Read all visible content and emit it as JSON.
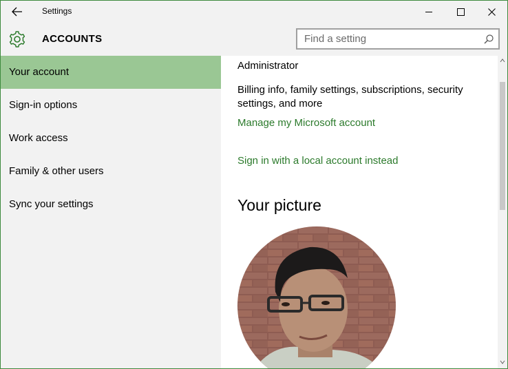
{
  "window": {
    "title": "Settings",
    "back_icon": "back-arrow-icon",
    "minimize_icon": "minimize-icon",
    "maximize_icon": "maximize-icon",
    "close_icon": "close-icon"
  },
  "header": {
    "icon": "gear-icon",
    "title": "ACCOUNTS",
    "search_placeholder": "Find a setting",
    "search_value": "",
    "search_icon": "search-icon"
  },
  "sidebar": {
    "items": [
      {
        "label": "Your account",
        "selected": true
      },
      {
        "label": "Sign-in options",
        "selected": false
      },
      {
        "label": "Work access",
        "selected": false
      },
      {
        "label": "Family & other users",
        "selected": false
      },
      {
        "label": "Sync your settings",
        "selected": false
      }
    ]
  },
  "content": {
    "role": "Administrator",
    "billing_text_line1": "Billing info, family settings, subscriptions, security",
    "billing_text_line2": "settings, and more",
    "manage_link": "Manage my Microsoft account",
    "local_account_link": "Sign in with a local account instead",
    "picture_heading": "Your picture"
  },
  "colors": {
    "accent": "#2b7a2b",
    "selected_nav": "#9ac794",
    "chrome_bg": "#f2f2f2",
    "window_border": "#3d8a3d"
  }
}
